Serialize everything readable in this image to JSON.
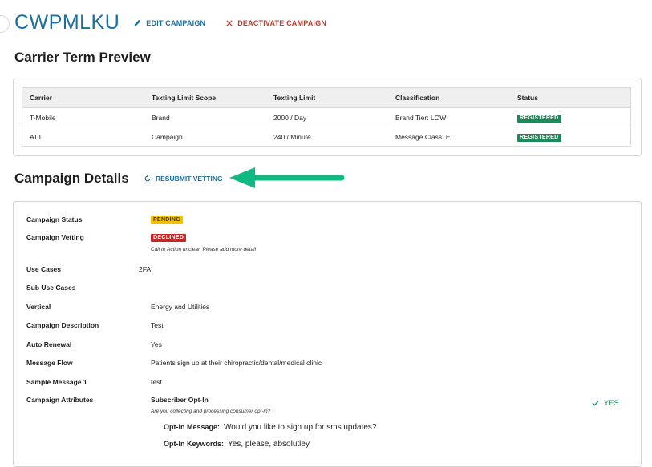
{
  "header": {
    "campaign_id": "CWPMLKU",
    "edit_label": "EDIT CAMPAIGN",
    "deactivate_label": "DEACTIVATE CAMPAIGN"
  },
  "carrier_preview": {
    "title": "Carrier Term Preview",
    "columns": [
      "Carrier",
      "Texting Limit Scope",
      "Texting Limit",
      "Classification",
      "Status"
    ],
    "rows": [
      {
        "carrier": "T-Mobile",
        "scope": "Brand",
        "limit": "2000 / Day",
        "classification": "Brand Tier: LOW",
        "status": "REGISTERED"
      },
      {
        "carrier": "ATT",
        "scope": "Campaign",
        "limit": "240 / Minute",
        "classification": "Message Class: E",
        "status": "REGISTERED"
      }
    ]
  },
  "details": {
    "title": "Campaign Details",
    "resubmit_label": "RESUBMIT VETTING",
    "status_label": "Campaign Status",
    "status_value": "PENDING",
    "vetting_label": "Campaign Vetting",
    "vetting_value": "DECLINED",
    "vetting_note": "Call to Action unclear. Please add more detail",
    "use_cases_label": "Use Cases",
    "use_cases_value": "2FA",
    "sub_use_cases_label": "Sub Use Cases",
    "vertical_label": "Vertical",
    "vertical_value": "Energy and Utilities",
    "description_label": "Campaign Description",
    "description_value": "Test",
    "auto_renewal_label": "Auto Renewal",
    "auto_renewal_value": "Yes",
    "message_flow_label": "Message Flow",
    "message_flow_value": "Patients sign up at their chiropractic/dental/medical clinic",
    "sample_label": "Sample Message 1",
    "sample_value": "test",
    "attributes_label": "Campaign Attributes",
    "optin_title": "Subscriber Opt-In",
    "optin_question": "Are you collecting and processing consumer opt-in?",
    "optin_answer": "YES",
    "optin_message_label": "Opt-In Message:",
    "optin_message_value": "Would you like to sign up for sms updates?",
    "optin_keywords_label": "Opt-In Keywords:",
    "optin_keywords_value": "Yes, please, absolutley"
  },
  "colors": {
    "accent": "#1a6fa0",
    "danger": "#c0392b",
    "success": "#1a8a58",
    "pending": "#f2c200",
    "arrow": "#10b981"
  }
}
